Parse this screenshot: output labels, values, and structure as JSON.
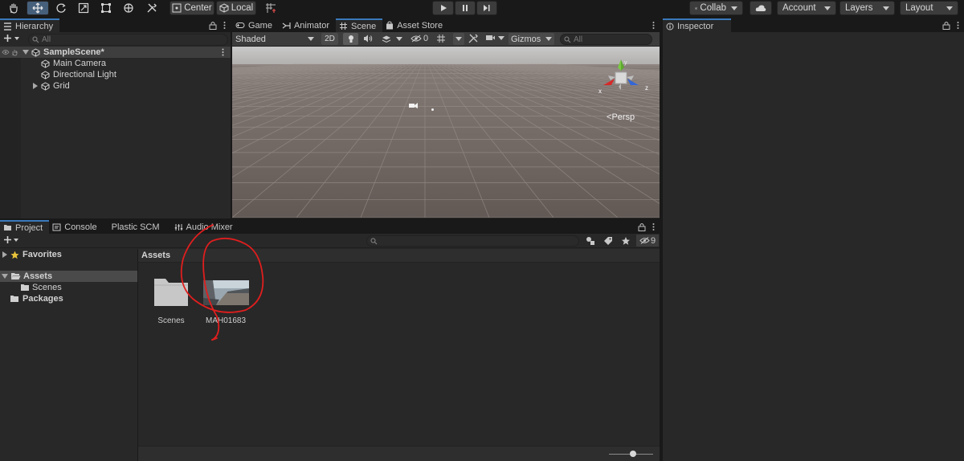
{
  "toolbar": {
    "tools": [
      "hand-tool",
      "move-tool",
      "rotate-tool",
      "scale-tool",
      "rect-tool",
      "transform-tool",
      "custom-tool"
    ],
    "pivot_label": "Center",
    "space_label": "Local",
    "collab_label": "Collab",
    "account_label": "Account",
    "layers_label": "Layers",
    "layout_label": "Layout"
  },
  "hierarchy": {
    "tab_label": "Hierarchy",
    "search_placeholder": "All",
    "scene_name": "SampleScene*",
    "items": [
      {
        "label": "Main Camera"
      },
      {
        "label": "Directional Light"
      },
      {
        "label": "Grid"
      }
    ]
  },
  "scene_tabs": [
    {
      "label": "Game"
    },
    {
      "label": "Animator"
    },
    {
      "label": "Scene"
    },
    {
      "label": "Asset Store"
    }
  ],
  "scene_toolbar": {
    "shading_mode": "Shaded",
    "mode_2d": "2D",
    "hidden_count": "0",
    "gizmos_label": "Gizmos",
    "search_placeholder": "All"
  },
  "scene_view": {
    "gizmo_x": "x",
    "gizmo_y": "y",
    "gizmo_z": "z",
    "projection_label": "Persp",
    "colors": {
      "sky": "#c7c7c7",
      "ground": "#6a625f",
      "x_axis": "#d62a2a",
      "y_axis": "#7ac943",
      "z_axis": "#3366d6"
    }
  },
  "inspector": {
    "tab_label": "Inspector"
  },
  "bottom_tabs": [
    {
      "label": "Project"
    },
    {
      "label": "Console"
    },
    {
      "label": "Plastic SCM"
    },
    {
      "label": "Audio Mixer"
    }
  ],
  "project": {
    "hidden_count": "9",
    "favorites_label": "Favorites",
    "assets_label": "Assets",
    "scenes_label": "Scenes",
    "packages_label": "Packages",
    "breadcrumb": "Assets",
    "grid_items": [
      {
        "label": "Scenes",
        "icon": "folder-icon"
      },
      {
        "label": "MAH01683",
        "icon": "video-thumbnail"
      }
    ]
  },
  "colors": {
    "accent": "#3a79bb",
    "selection": "#46607c",
    "annotation": "#e01e1e"
  }
}
